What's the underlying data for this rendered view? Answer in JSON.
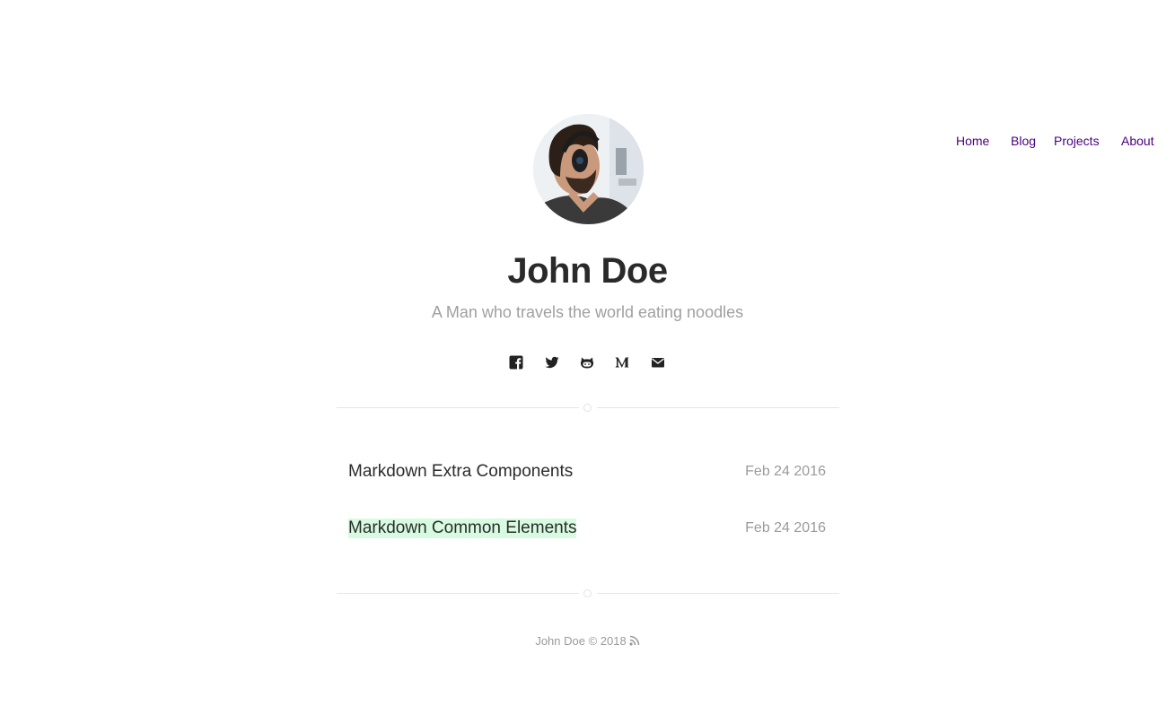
{
  "nav": {
    "home": "Home",
    "blog": "Blog",
    "projects": "Projects",
    "about": "About"
  },
  "profile": {
    "avatar": "avatar-photo",
    "name": "John Doe",
    "tagline": "A Man who travels the world eating noodles"
  },
  "social": [
    {
      "icon": "facebook-icon"
    },
    {
      "icon": "twitter-icon"
    },
    {
      "icon": "github-icon"
    },
    {
      "icon": "medium-icon"
    },
    {
      "icon": "mail-icon"
    }
  ],
  "posts": [
    {
      "title": "Markdown Extra Components",
      "date": "Feb 24 2016"
    },
    {
      "title": "Markdown Common Elements",
      "date": "Feb 24 2016"
    }
  ],
  "footer": {
    "text": "John Doe © 2018",
    "icon": "rss-icon"
  },
  "colors": {
    "nav_link": "#4b0082",
    "highlight": "#d7fbe1",
    "muted": "#9a9a9a"
  }
}
